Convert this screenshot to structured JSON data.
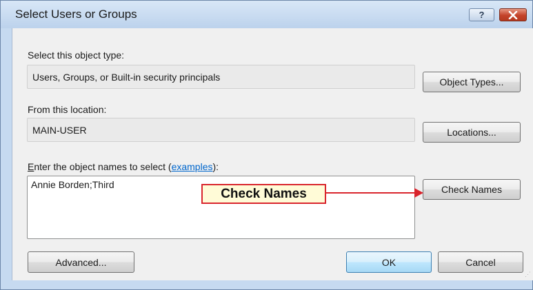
{
  "window": {
    "title": "Select Users or Groups",
    "help_label": "?",
    "close_label": "✕"
  },
  "object_type": {
    "label": "Select this object type:",
    "value": "Users, Groups, or Built-in security principals",
    "button_label": "Object Types..."
  },
  "location": {
    "label": "From this location:",
    "value": "MAIN-USER",
    "button_label": "Locations..."
  },
  "names": {
    "label_accesskey": "E",
    "label_rest": "nter the object names to select (",
    "label_link": "examples",
    "label_end": "):",
    "value": "Annie Borden;Third",
    "check_button_label": "Check Names"
  },
  "callout": {
    "text": "Check Names",
    "color": "#d9242c"
  },
  "footer": {
    "advanced_label": "Advanced...",
    "ok_label": "OK",
    "cancel_label": "Cancel"
  }
}
